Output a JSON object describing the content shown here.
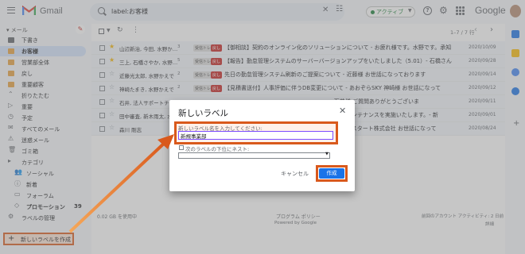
{
  "header": {
    "app_name": "Gmail",
    "search_query": "label:お客様",
    "status_label": "アクティブ",
    "brand_word": "Google"
  },
  "sidebar": {
    "section_mail": "メール",
    "items": [
      {
        "label": "下書き"
      },
      {
        "label": "お客様"
      },
      {
        "label": "営業部全体"
      },
      {
        "label": "戻し"
      },
      {
        "label": "重要顧客"
      },
      {
        "label": "折りたたむ"
      },
      {
        "label": "重要"
      },
      {
        "label": "予定"
      },
      {
        "label": "すべてのメール"
      },
      {
        "label": "迷惑メール"
      },
      {
        "label": "ゴミ箱"
      },
      {
        "label": "カテゴリ"
      },
      {
        "label": "ソーシャル"
      },
      {
        "label": "新着"
      },
      {
        "label": "フォーラム"
      },
      {
        "label": "プロモーション"
      },
      {
        "label": "ラベルの管理"
      },
      {
        "label": "新しいラベルを作成"
      }
    ],
    "promo_count": "39"
  },
  "toolbar": {
    "pagination": "1–7 / 7 行"
  },
  "emails": [
    {
      "sender": "山辺新治, 今田, 水野か…",
      "count": "3",
      "tag1": "受信トレイ",
      "tag2": "戻し",
      "subject": "【御相談】契約のオンライン化のソリューションについて - お疲れ様です。水野です。承知",
      "date": "2020/10/09"
    },
    {
      "sender": "三上, 石橋さやか, 水野…",
      "count": "5",
      "tag1": "受信トレイ",
      "tag2": "戻し",
      "subject": "【報告】勤怠管理システムのサーバーバージョンアップをいたしました（5.01）- 石橋さん",
      "date": "2020/09/28"
    },
    {
      "sender": "近藤光太郎, 水野かえで",
      "count": "2",
      "tag1": "受信トレイ",
      "tag2": "戻し",
      "subject": "先日の勤怠管理システム刷新のご提案について - 近藤様 お世話になっております",
      "date": "2020/09/14"
    },
    {
      "sender": "神崎たまき, 水野かえで",
      "count": "2",
      "tag1": "受信トレイ",
      "tag2": "戻し",
      "subject": "【見積書送付】人事評価に伴うDB変更について - あおぞらSKY 神崎様 お世話になって",
      "date": "2020/09/12"
    },
    {
      "sender": "石井, 法人サポートチ…",
      "count": "",
      "tag1": "",
      "tag2": "",
      "subject": "- 石井様 ご質問ありがとうございま",
      "date": "2020/09/11"
    },
    {
      "sender": "田中審査, 新木雨太, 水野",
      "count": "",
      "tag1": "",
      "tag2": "",
      "subject": "メンテナンスを実施いたします。- 新",
      "date": "2020/09/01"
    },
    {
      "sender": "森川 剛志",
      "count": "",
      "tag1": "",
      "tag2": "",
      "subject": "イスタート株式会社 お世話になって",
      "date": "2020/08/24"
    }
  ],
  "footer": {
    "storage": "0.02 GB を使用中",
    "policy": "プログラム ポリシー",
    "powered": "Powered by Google",
    "activity": "前回のアカウント アクティビティ: 2 日前",
    "details": "詳細"
  },
  "dialog": {
    "title": "新しいラベル",
    "prompt": "新しいラベル名を入力してください:",
    "input_value": "新規事業部",
    "nest_label": "次のラベルの下位にネスト:",
    "cancel_label": "キャンセル",
    "create_label": "作成"
  },
  "colors": {
    "annotation": "#d9591c",
    "primary_button": "#1a73e8",
    "active_nav": "#d3e3fd",
    "tag_red": "#c5221f"
  }
}
